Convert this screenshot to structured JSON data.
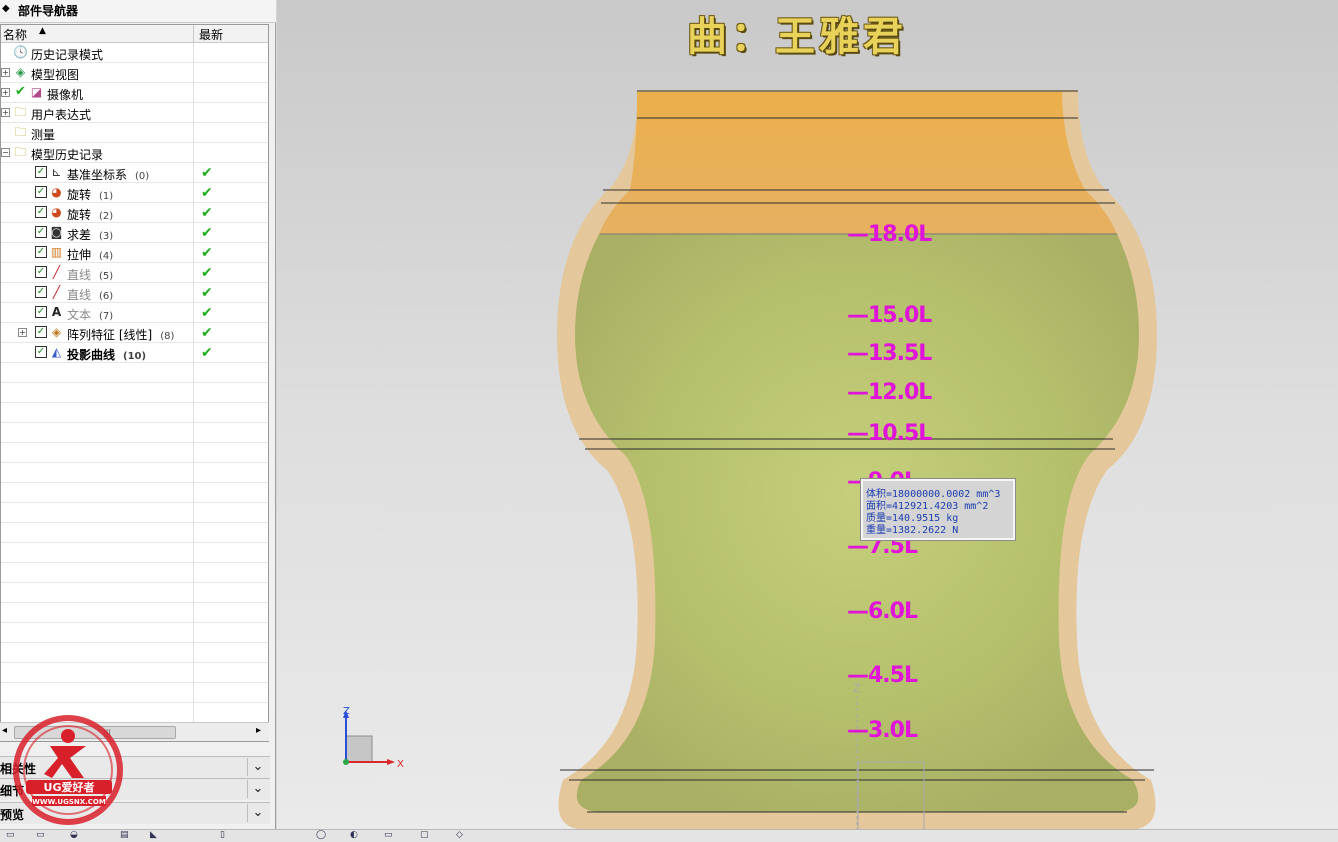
{
  "navigator": {
    "title": "部件导航器",
    "columns": {
      "name": "名称",
      "latest": "最新"
    },
    "items": [
      {
        "label": "历史记录模式",
        "num": "",
        "icon": "clock-icon",
        "latest": false
      },
      {
        "label": "模型视图",
        "num": "",
        "icon": "model-view-icon",
        "latest": false
      },
      {
        "label": "摄像机",
        "num": "",
        "icon": "camera-icon",
        "latest": false
      },
      {
        "label": "用户表达式",
        "num": "",
        "icon": "folder-icon",
        "latest": false
      },
      {
        "label": "测量",
        "num": "",
        "icon": "folder-icon",
        "latest": false
      },
      {
        "label": "模型历史记录",
        "num": "",
        "icon": "folder-icon",
        "latest": false
      },
      {
        "label": "基准坐标系",
        "num": "(0)",
        "icon": "datum-csys-icon",
        "latest": true
      },
      {
        "label": "旋转",
        "num": "(1)",
        "icon": "revolve-icon",
        "latest": true
      },
      {
        "label": "旋转",
        "num": "(2)",
        "icon": "revolve-icon",
        "latest": true
      },
      {
        "label": "求差",
        "num": "(3)",
        "icon": "subtract-icon",
        "latest": true
      },
      {
        "label": "拉伸",
        "num": "(4)",
        "icon": "extrude-icon",
        "latest": true
      },
      {
        "label": "直线",
        "num": "(5)",
        "icon": "line-icon",
        "latest": true
      },
      {
        "label": "直线",
        "num": "(6)",
        "icon": "line-icon",
        "latest": true
      },
      {
        "label": "文本",
        "num": "(7)",
        "icon": "text-icon",
        "latest": true
      },
      {
        "label": "阵列特征 [线性]",
        "num": "(8)",
        "icon": "pattern-icon",
        "latest": true
      },
      {
        "label": "投影曲线",
        "num": "(10)",
        "icon": "project-curve-icon",
        "latest": true
      }
    ],
    "sections": [
      "相关性",
      "细节",
      "预览"
    ]
  },
  "viewport": {
    "title": "曲：王雅君",
    "scale_marks": [
      "18.0L",
      "15.0L",
      "13.5L",
      "12.0L",
      "10.5L",
      "7.5L",
      "6.0L",
      "4.5L",
      "3.0L"
    ],
    "hidden_mark": "9.0L",
    "measure_info": [
      "体积=18000000.0002 mm^3",
      "面积=412921.4203 mm^2",
      "质量=140.9515 kg",
      "重量=1382.2622 N"
    ],
    "axes": {
      "z": "Z",
      "x": "X"
    },
    "colors": {
      "title": "#e8d25a",
      "marks": "#e014d8",
      "liquid": "#b5c46a",
      "glass": "#e3c496",
      "top_band": "#e8ae4c"
    }
  },
  "watermark": {
    "brand": "UG爱好者",
    "url": "WWW.UGSNX.COM"
  }
}
